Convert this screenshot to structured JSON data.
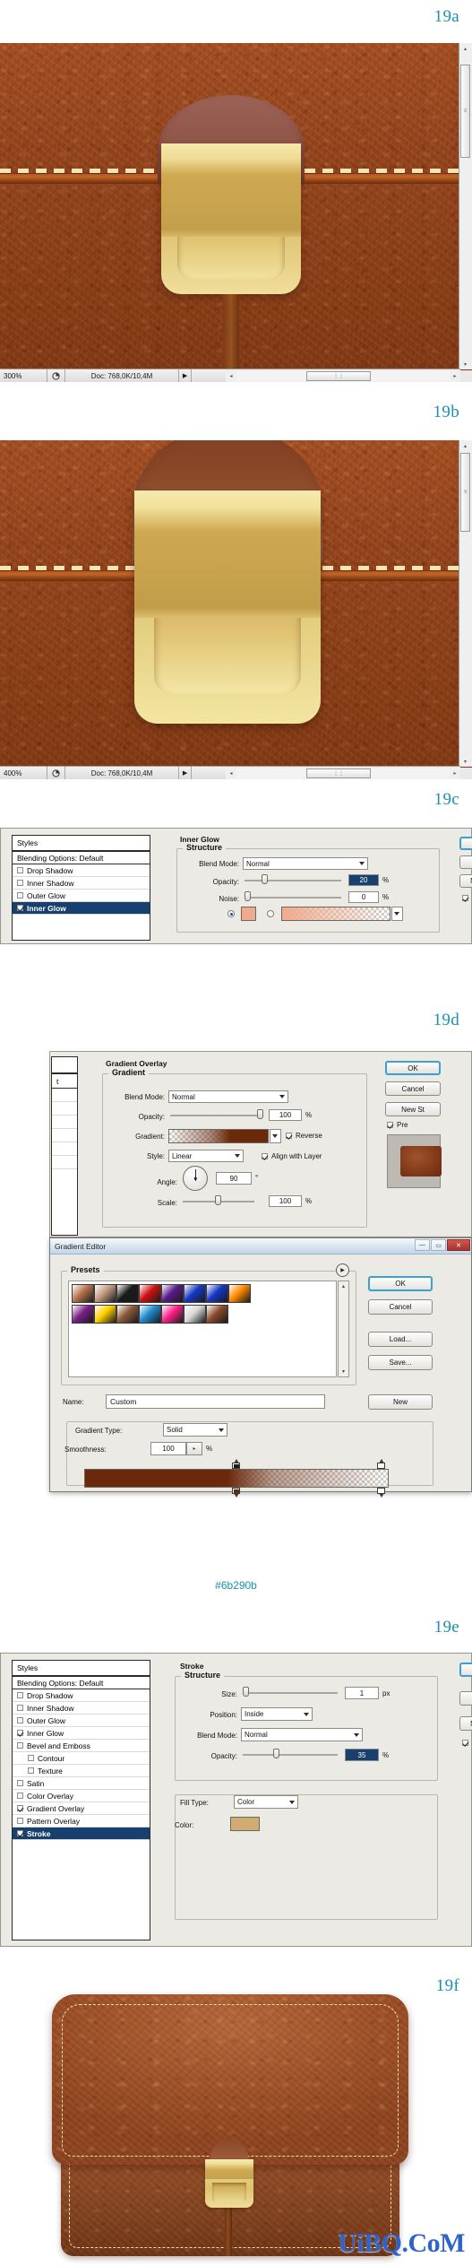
{
  "steps": {
    "a": "19a",
    "b": "19b",
    "c": "19c",
    "d": "19d",
    "e": "19e",
    "f": "19f"
  },
  "canvas_a": {
    "status": {
      "zoom": "300%",
      "doc": "Doc: 768,0K/10,4M",
      "arrow": "▶",
      "left_arrow": "◂",
      "right_arrow": "▸",
      "up_arrow": "▴",
      "down_arrow": "▾",
      "thumb_grip": "⋮⋮",
      "vthumb_grip": "≡"
    }
  },
  "canvas_b": {
    "status": {
      "zoom": "400%",
      "doc": "Doc: 768,0K/10,4M",
      "arrow": "▶",
      "left_arrow": "◂",
      "right_arrow": "▸",
      "up_arrow": "▴",
      "down_arrow": "▾",
      "thumb_grip": "⋮⋮",
      "vthumb_grip": "≡"
    }
  },
  "dialog_c": {
    "styles_header": "Styles",
    "blending_options": "Blending Options: Default",
    "effects": [
      {
        "label": "Drop Shadow",
        "checked": false,
        "selected": false,
        "indent": false
      },
      {
        "label": "Inner Shadow",
        "checked": false,
        "selected": false,
        "indent": false
      },
      {
        "label": "Outer Glow",
        "checked": false,
        "selected": false,
        "indent": false
      },
      {
        "label": "Inner Glow",
        "checked": true,
        "selected": true,
        "indent": false
      }
    ],
    "section_title": "Inner Glow",
    "structure_title": "Structure",
    "fields": {
      "blend_mode_label": "Blend Mode:",
      "blend_mode_value": "Normal",
      "opacity_label": "Opacity:",
      "opacity_value": "20",
      "opacity_unit": "%",
      "noise_label": "Noise:",
      "noise_value": "0",
      "noise_unit": "%"
    },
    "glow_color": "#f0ab8d",
    "right_buttons": [
      "",
      "",
      "N"
    ]
  },
  "dialog_d": {
    "section_title": "Gradient Overlay",
    "group_title": "Gradient",
    "fields": {
      "blend_mode_label": "Blend Mode:",
      "blend_mode_value": "Normal",
      "opacity_label": "Opacity:",
      "opacity_value": "100",
      "opacity_unit": "%",
      "gradient_label": "Gradient:",
      "reverse_label": "Reverse",
      "reverse_checked": true,
      "style_label": "Style:",
      "style_value": "Linear",
      "align_label": "Align with Layer",
      "align_checked": true,
      "angle_label": "Angle:",
      "angle_value": "90",
      "angle_unit": "°",
      "scale_label": "Scale:",
      "scale_value": "100",
      "scale_unit": "%"
    },
    "right_buttons": {
      "ok": "OK",
      "cancel": "Cancel",
      "new_style": "New St",
      "preview": "Pre",
      "preview_checked": true
    },
    "gradient_editor": {
      "title": "Gradient Editor",
      "minimize": "—",
      "maximize": "▭",
      "close": "✕",
      "presets_label": "Presets",
      "presets_menu": "▶",
      "buttons": {
        "ok": "OK",
        "cancel": "Cancel",
        "load": "Load...",
        "save": "Save..."
      },
      "name_label": "Name:",
      "name_value": "Custom",
      "new_button": "New",
      "gradient_type_label": "Gradient Type:",
      "gradient_type_value": "Solid",
      "smoothness_label": "Smoothness:",
      "smoothness_value": "100",
      "smoothness_unit": "%",
      "scroll_up": "▴",
      "scroll_down": "▾",
      "presets_row1": [
        "#b6744a",
        "#c29a7e",
        "#1a1a1a",
        "#d01010",
        "#5b1a8a",
        "#1437c6",
        "#1437c6",
        "#ff8a00"
      ],
      "presets_row2": [
        "#7a1f86",
        "#ffd000",
        "#8a5a38",
        "#1f8ad0",
        "#ff1f8a",
        "#d8d8d8",
        "#8a4a2a"
      ]
    },
    "hex_note": "#6b290b",
    "gradient_stop_color": "#6b290b"
  },
  "dialog_e": {
    "styles_header": "Styles",
    "blending_options": "Blending Options: Default",
    "effects": [
      {
        "label": "Drop Shadow",
        "checked": false,
        "selected": false,
        "indent": false
      },
      {
        "label": "Inner Shadow",
        "checked": false,
        "selected": false,
        "indent": false
      },
      {
        "label": "Outer Glow",
        "checked": false,
        "selected": false,
        "indent": false
      },
      {
        "label": "Inner Glow",
        "checked": true,
        "selected": false,
        "indent": false
      },
      {
        "label": "Bevel and Emboss",
        "checked": false,
        "selected": false,
        "indent": false
      },
      {
        "label": "Contour",
        "checked": false,
        "selected": false,
        "indent": true
      },
      {
        "label": "Texture",
        "checked": false,
        "selected": false,
        "indent": true
      },
      {
        "label": "Satin",
        "checked": false,
        "selected": false,
        "indent": false
      },
      {
        "label": "Color Overlay",
        "checked": false,
        "selected": false,
        "indent": false
      },
      {
        "label": "Gradient Overlay",
        "checked": true,
        "selected": false,
        "indent": false
      },
      {
        "label": "Pattern Overlay",
        "checked": false,
        "selected": false,
        "indent": false
      },
      {
        "label": "Stroke",
        "checked": true,
        "selected": true,
        "indent": false
      }
    ],
    "section_title": "Stroke",
    "structure_title": "Structure",
    "fields": {
      "size_label": "Size:",
      "size_value": "1",
      "size_unit": "px",
      "position_label": "Position:",
      "position_value": "Inside",
      "blend_mode_label": "Blend Mode:",
      "blend_mode_value": "Normal",
      "opacity_label": "Opacity:",
      "opacity_value": "35",
      "opacity_unit": "%",
      "fill_type_label": "Fill Type:",
      "fill_type_value": "Color",
      "color_label": "Color:"
    },
    "stroke_color": "#d2ab72",
    "right_buttons": [
      "",
      "",
      "N"
    ]
  },
  "result": {
    "watermark": "UiBQ.CoM"
  },
  "palette": {
    "label_blue": "#1a8fb0",
    "leather_light": "#a14c21",
    "leather_dark": "#8e4019",
    "clasp_gold_light": "#f6e6a4",
    "clasp_gold_mid": "#c9a24e",
    "clasp_gold_dark": "#b8913f",
    "dome_brown": "#9d6257",
    "stitch": "#f0dfae",
    "selection_blue": "#17406e",
    "watermark_blue": "#2f63c8"
  }
}
